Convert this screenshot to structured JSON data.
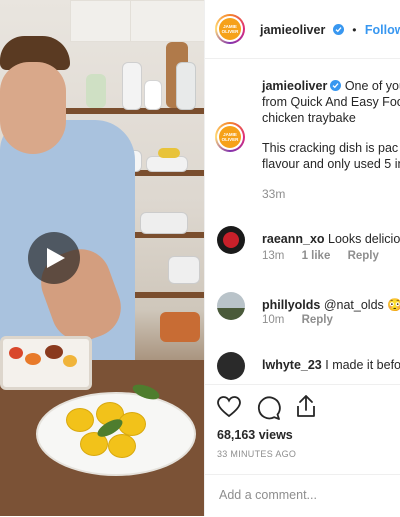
{
  "post": {
    "username": "jamieoliver",
    "follow_label": "Follow",
    "separator": "•",
    "avatar_text": "JAMIE OLIVER",
    "caption_line1": "One of you",
    "caption_line2": "from Quick And Easy Foo",
    "caption_line3": "chicken traybake",
    "caption_line4": "This cracking dish is pac",
    "caption_line5": "flavour and only used 5 in",
    "caption_time": "33m",
    "views": "68,163 views",
    "posted_ago": "33 MINUTES AGO"
  },
  "comments": [
    {
      "user": "raeann_xo",
      "text": "Looks deliciou",
      "time": "13m",
      "likes": "1 like",
      "reply": "Reply"
    },
    {
      "user": "phillyolds",
      "text": "@nat_olds 😳",
      "time": "10m",
      "likes": "",
      "reply": "Reply"
    },
    {
      "user": "lwhyte_23",
      "text": "I made it befo",
      "time": "",
      "likes": "",
      "reply": ""
    }
  ],
  "comment_box": {
    "placeholder": "Add a comment..."
  },
  "icons": {
    "play": "play-icon",
    "like": "heart-icon",
    "comment": "comment-icon",
    "share": "share-icon",
    "verified": "verified-badge-icon"
  },
  "colors": {
    "accent": "#3897f0",
    "muted": "#8e8e8e",
    "text": "#262626",
    "avatar_brand": "#f6a11a"
  }
}
